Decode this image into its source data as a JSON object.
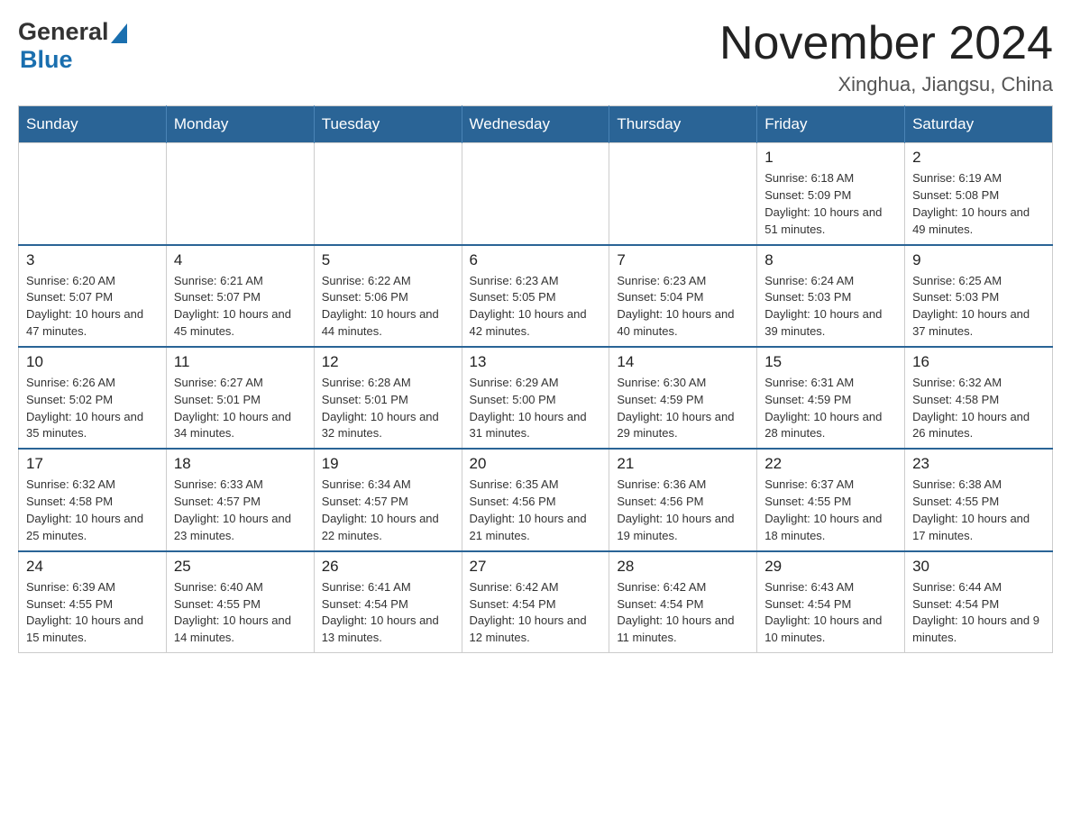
{
  "header": {
    "logo_general": "General",
    "logo_blue": "Blue",
    "month_title": "November 2024",
    "location": "Xinghua, Jiangsu, China"
  },
  "weekdays": [
    "Sunday",
    "Monday",
    "Tuesday",
    "Wednesday",
    "Thursday",
    "Friday",
    "Saturday"
  ],
  "weeks": [
    [
      {
        "day": "",
        "info": ""
      },
      {
        "day": "",
        "info": ""
      },
      {
        "day": "",
        "info": ""
      },
      {
        "day": "",
        "info": ""
      },
      {
        "day": "",
        "info": ""
      },
      {
        "day": "1",
        "info": "Sunrise: 6:18 AM\nSunset: 5:09 PM\nDaylight: 10 hours and 51 minutes."
      },
      {
        "day": "2",
        "info": "Sunrise: 6:19 AM\nSunset: 5:08 PM\nDaylight: 10 hours and 49 minutes."
      }
    ],
    [
      {
        "day": "3",
        "info": "Sunrise: 6:20 AM\nSunset: 5:07 PM\nDaylight: 10 hours and 47 minutes."
      },
      {
        "day": "4",
        "info": "Sunrise: 6:21 AM\nSunset: 5:07 PM\nDaylight: 10 hours and 45 minutes."
      },
      {
        "day": "5",
        "info": "Sunrise: 6:22 AM\nSunset: 5:06 PM\nDaylight: 10 hours and 44 minutes."
      },
      {
        "day": "6",
        "info": "Sunrise: 6:23 AM\nSunset: 5:05 PM\nDaylight: 10 hours and 42 minutes."
      },
      {
        "day": "7",
        "info": "Sunrise: 6:23 AM\nSunset: 5:04 PM\nDaylight: 10 hours and 40 minutes."
      },
      {
        "day": "8",
        "info": "Sunrise: 6:24 AM\nSunset: 5:03 PM\nDaylight: 10 hours and 39 minutes."
      },
      {
        "day": "9",
        "info": "Sunrise: 6:25 AM\nSunset: 5:03 PM\nDaylight: 10 hours and 37 minutes."
      }
    ],
    [
      {
        "day": "10",
        "info": "Sunrise: 6:26 AM\nSunset: 5:02 PM\nDaylight: 10 hours and 35 minutes."
      },
      {
        "day": "11",
        "info": "Sunrise: 6:27 AM\nSunset: 5:01 PM\nDaylight: 10 hours and 34 minutes."
      },
      {
        "day": "12",
        "info": "Sunrise: 6:28 AM\nSunset: 5:01 PM\nDaylight: 10 hours and 32 minutes."
      },
      {
        "day": "13",
        "info": "Sunrise: 6:29 AM\nSunset: 5:00 PM\nDaylight: 10 hours and 31 minutes."
      },
      {
        "day": "14",
        "info": "Sunrise: 6:30 AM\nSunset: 4:59 PM\nDaylight: 10 hours and 29 minutes."
      },
      {
        "day": "15",
        "info": "Sunrise: 6:31 AM\nSunset: 4:59 PM\nDaylight: 10 hours and 28 minutes."
      },
      {
        "day": "16",
        "info": "Sunrise: 6:32 AM\nSunset: 4:58 PM\nDaylight: 10 hours and 26 minutes."
      }
    ],
    [
      {
        "day": "17",
        "info": "Sunrise: 6:32 AM\nSunset: 4:58 PM\nDaylight: 10 hours and 25 minutes."
      },
      {
        "day": "18",
        "info": "Sunrise: 6:33 AM\nSunset: 4:57 PM\nDaylight: 10 hours and 23 minutes."
      },
      {
        "day": "19",
        "info": "Sunrise: 6:34 AM\nSunset: 4:57 PM\nDaylight: 10 hours and 22 minutes."
      },
      {
        "day": "20",
        "info": "Sunrise: 6:35 AM\nSunset: 4:56 PM\nDaylight: 10 hours and 21 minutes."
      },
      {
        "day": "21",
        "info": "Sunrise: 6:36 AM\nSunset: 4:56 PM\nDaylight: 10 hours and 19 minutes."
      },
      {
        "day": "22",
        "info": "Sunrise: 6:37 AM\nSunset: 4:55 PM\nDaylight: 10 hours and 18 minutes."
      },
      {
        "day": "23",
        "info": "Sunrise: 6:38 AM\nSunset: 4:55 PM\nDaylight: 10 hours and 17 minutes."
      }
    ],
    [
      {
        "day": "24",
        "info": "Sunrise: 6:39 AM\nSunset: 4:55 PM\nDaylight: 10 hours and 15 minutes."
      },
      {
        "day": "25",
        "info": "Sunrise: 6:40 AM\nSunset: 4:55 PM\nDaylight: 10 hours and 14 minutes."
      },
      {
        "day": "26",
        "info": "Sunrise: 6:41 AM\nSunset: 4:54 PM\nDaylight: 10 hours and 13 minutes."
      },
      {
        "day": "27",
        "info": "Sunrise: 6:42 AM\nSunset: 4:54 PM\nDaylight: 10 hours and 12 minutes."
      },
      {
        "day": "28",
        "info": "Sunrise: 6:42 AM\nSunset: 4:54 PM\nDaylight: 10 hours and 11 minutes."
      },
      {
        "day": "29",
        "info": "Sunrise: 6:43 AM\nSunset: 4:54 PM\nDaylight: 10 hours and 10 minutes."
      },
      {
        "day": "30",
        "info": "Sunrise: 6:44 AM\nSunset: 4:54 PM\nDaylight: 10 hours and 9 minutes."
      }
    ]
  ]
}
